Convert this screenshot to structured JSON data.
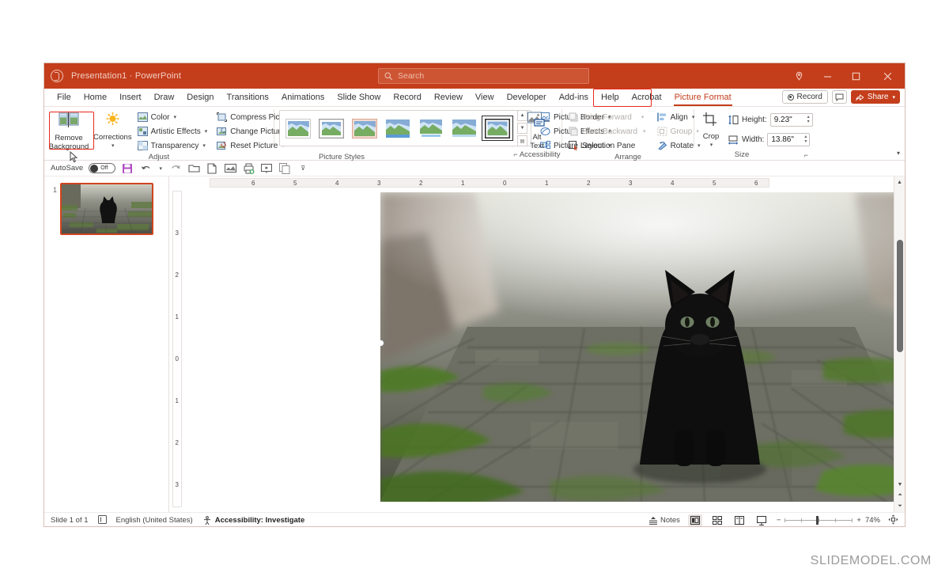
{
  "window": {
    "title": "Presentation1  ·  PowerPoint",
    "logo_icon": "powerpoint-logo-icon"
  },
  "search": {
    "placeholder": "Search",
    "icon": "search-icon"
  },
  "window_controls": {
    "help": "pin-icon",
    "minimize": "minimize-icon",
    "maximize": "maximize-icon",
    "close": "close-icon"
  },
  "tabs": [
    {
      "label": "File"
    },
    {
      "label": "Home"
    },
    {
      "label": "Insert"
    },
    {
      "label": "Draw"
    },
    {
      "label": "Design"
    },
    {
      "label": "Transitions"
    },
    {
      "label": "Animations"
    },
    {
      "label": "Slide Show"
    },
    {
      "label": "Record"
    },
    {
      "label": "Review"
    },
    {
      "label": "View"
    },
    {
      "label": "Developer"
    },
    {
      "label": "Add-ins"
    },
    {
      "label": "Help"
    },
    {
      "label": "Acrobat"
    },
    {
      "label": "Picture Format"
    }
  ],
  "tab_actions": {
    "record_label": "Record",
    "comments_icon": "comment-icon",
    "share_label": "Share",
    "share_icon": "share-icon",
    "share_chevron": "chevron-down-icon"
  },
  "ribbon": {
    "adjust": {
      "group_label": "Adjust",
      "remove_background": {
        "line1": "Remove",
        "line2": "Background",
        "icon": "remove-background-icon"
      },
      "corrections": {
        "label": "Corrections",
        "icon": "brightness-icon",
        "chevron": "chevron-down-icon"
      },
      "items": [
        {
          "label": "Color",
          "icon": "color-icon",
          "chevron": "chevron-down-icon"
        },
        {
          "label": "Artistic Effects",
          "icon": "artistic-effects-icon",
          "chevron": "chevron-down-icon"
        },
        {
          "label": "Transparency",
          "icon": "transparency-icon",
          "chevron": "chevron-down-icon"
        },
        {
          "label": "Compress Pictures",
          "icon": "compress-pictures-icon",
          "chevron": ""
        },
        {
          "label": "Change Picture",
          "icon": "change-picture-icon",
          "chevron": "chevron-down-icon"
        },
        {
          "label": "Reset Picture",
          "icon": "reset-picture-icon",
          "chevron": "chevron-down-icon"
        }
      ]
    },
    "picture_styles": {
      "group_label": "Picture Styles",
      "thumbnail_count": 7,
      "selected_index": 6,
      "scroll_up_icon": "scroll-up-icon",
      "scroll_down_icon": "scroll-down-icon",
      "more_icon": "gallery-more-icon",
      "items": [
        {
          "label": "Picture Border",
          "icon": "picture-border-icon",
          "chevron": "chevron-down-icon"
        },
        {
          "label": "Picture Effects",
          "icon": "picture-effects-icon",
          "chevron": "chevron-down-icon"
        },
        {
          "label": "Picture Layout",
          "icon": "picture-layout-icon",
          "chevron": "chevron-down-icon"
        }
      ]
    },
    "accessibility": {
      "group_label": "Accessibility",
      "alt_text": {
        "line1": "Alt",
        "line2": "Text",
        "icon": "alt-text-icon"
      },
      "dialog_launcher": "dialog-launcher-icon"
    },
    "arrange": {
      "group_label": "Arrange",
      "items": [
        {
          "label": "Bring Forward",
          "icon": "bring-forward-icon",
          "chevron": "chevron-down-icon",
          "disabled": true
        },
        {
          "label": "Send Backward",
          "icon": "send-backward-icon",
          "chevron": "chevron-down-icon",
          "disabled": true
        },
        {
          "label": "Selection Pane",
          "icon": "selection-pane-icon",
          "chevron": "",
          "disabled": false
        },
        {
          "label": "Align",
          "icon": "align-icon",
          "chevron": "chevron-down-icon",
          "disabled": false
        },
        {
          "label": "Group",
          "icon": "group-icon",
          "chevron": "chevron-down-icon",
          "disabled": true
        },
        {
          "label": "Rotate",
          "icon": "rotate-icon",
          "chevron": "chevron-down-icon",
          "disabled": false
        }
      ]
    },
    "size": {
      "group_label": "Size",
      "crop": {
        "label": "Crop",
        "icon": "crop-icon",
        "chevron": "chevron-down-icon"
      },
      "height_label": "Height:",
      "height_value": "9.23\"",
      "width_label": "Width:",
      "width_value": "13.86\"",
      "dialog_launcher": "dialog-launcher-icon"
    },
    "collapse_icon": "chevron-down-icon"
  },
  "quick_access": {
    "autosave_label": "AutoSave",
    "autosave_state": "Off",
    "buttons": [
      {
        "icon": "save-icon"
      },
      {
        "icon": "undo-icon"
      },
      {
        "icon": "undo-chevron-icon"
      },
      {
        "icon": "redo-icon"
      },
      {
        "icon": "open-icon"
      },
      {
        "icon": "new-slide-icon"
      },
      {
        "icon": "picture-icon"
      },
      {
        "icon": "print-preview-icon"
      },
      {
        "icon": "start-slideshow-icon"
      },
      {
        "icon": "copy-icon"
      },
      {
        "icon": "customize-qat-icon"
      }
    ]
  },
  "slide_panel": {
    "slide_number": "1"
  },
  "rulers": {
    "horizontal_labels": [
      "6",
      "5",
      "4",
      "3",
      "2",
      "1",
      "0",
      "1",
      "2",
      "3",
      "4",
      "5",
      "6"
    ],
    "vertical_labels": [
      "3",
      "2",
      "1",
      "0",
      "1",
      "2",
      "3"
    ]
  },
  "canvas": {
    "image_description": "black kitten sitting on mossy cobblestone alley",
    "selection_handles": 2
  },
  "status_bar": {
    "slide_count": "Slide 1 of 1",
    "notes_icon_label": "notes-icon",
    "language": "English (United States)",
    "accessibility_icon": "accessibility-icon",
    "accessibility": "Accessibility: Investigate",
    "notes_label": "Notes",
    "views": [
      {
        "icon": "normal-view-icon",
        "active": true
      },
      {
        "icon": "slide-sorter-icon",
        "active": false
      },
      {
        "icon": "reading-view-icon",
        "active": false
      },
      {
        "icon": "slideshow-view-icon",
        "active": false
      }
    ],
    "zoom_out": "−",
    "zoom_in": "+",
    "zoom_level": "74%",
    "fit_icon": "fit-to-window-icon"
  },
  "watermark": "SLIDEMODEL.COM",
  "colors": {
    "brand": "#c43e1c",
    "annotation": "#e8291c",
    "thumb_border": "#d0451f"
  }
}
